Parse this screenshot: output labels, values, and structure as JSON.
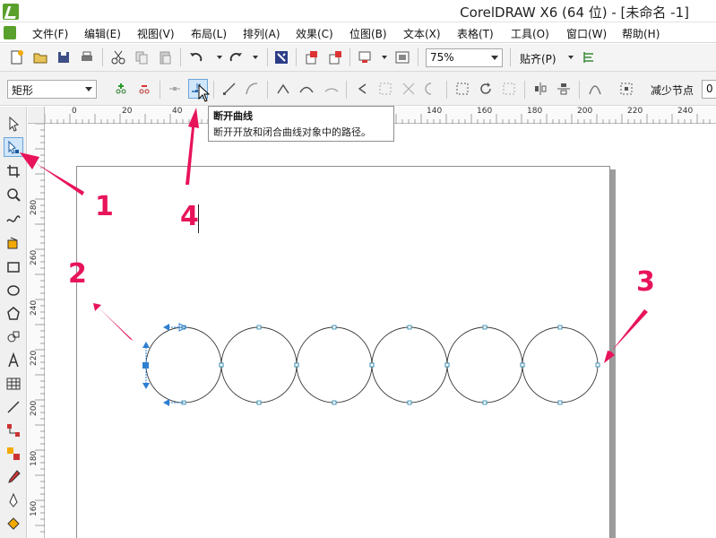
{
  "window": {
    "title": "CorelDRAW X6 (64 位) - [未命名 -1]"
  },
  "menu": {
    "items": [
      "文件(F)",
      "编辑(E)",
      "视图(V)",
      "布局(L)",
      "排列(A)",
      "效果(C)",
      "位图(B)",
      "文本(X)",
      "表格(T)",
      "工具(O)",
      "窗口(W)",
      "帮助(H)"
    ]
  },
  "toolbar": {
    "zoom_value": "75%",
    "snap_label": "贴齐(P)"
  },
  "property_bar": {
    "shape_type": "矩形",
    "reduce_nodes_label": "减少节点",
    "reduce_nodes_value": "0"
  },
  "tooltip": {
    "title": "断开曲线",
    "description": "断开开放和闭合曲线对象中的路径。"
  },
  "ruler": {
    "top_ticks": [
      "0",
      "20",
      "40",
      "140",
      "160",
      "180",
      "200",
      "220",
      "240"
    ],
    "left_ticks": [
      "280",
      "260",
      "240",
      "220",
      "200",
      "180",
      "160"
    ]
  },
  "annotations": {
    "label_1": "1",
    "label_2": "2",
    "label_3": "3",
    "label_4": "4"
  },
  "drawing": {
    "circle_count": 6
  },
  "icons": {
    "pick_tool": "pick-tool-icon",
    "shape_tool": "shape-tool-icon",
    "break_curve": "break-curve-icon"
  },
  "colors": {
    "annotation": "#e8145a",
    "selection": "#2f7fd0",
    "circle_stroke": "#3a3a3a"
  }
}
